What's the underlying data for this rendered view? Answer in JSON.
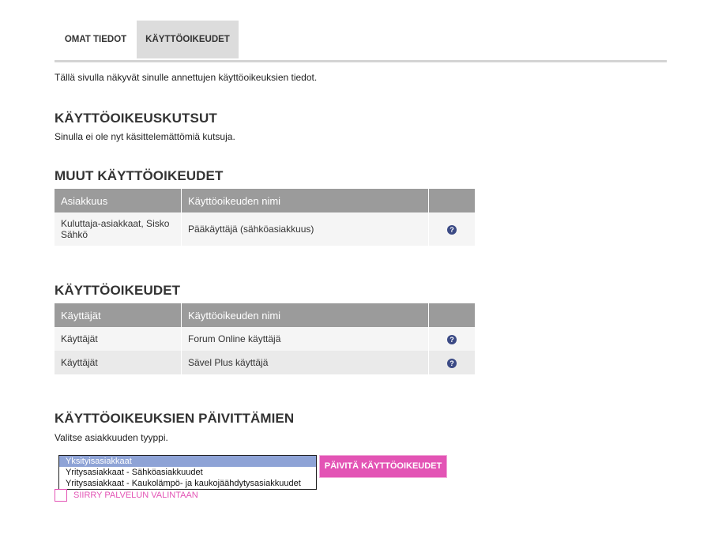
{
  "tabs": [
    {
      "label": "OMAT TIEDOT",
      "active": false
    },
    {
      "label": "KÄYTTÖOIKEUDET",
      "active": true
    }
  ],
  "intro": "Tällä sivulla näkyvät sinulle annettujen käyttöoikeuksien tiedot.",
  "invites": {
    "title": "KÄYTTÖOIKEUSKUTSUT",
    "text": "Sinulla ei ole nyt käsittelemättömiä kutsuja."
  },
  "other_rights": {
    "title": "MUUT KÄYTTÖOIKEUDET",
    "headers": [
      "Asiakkuus",
      "Käyttöoikeuden nimi"
    ],
    "rows": [
      {
        "col1": "Kuluttaja-asiakkaat, Sisko Sähkö",
        "col2": "Pääkäyttäjä (sähköasiakkuus)"
      }
    ]
  },
  "rights": {
    "title": "KÄYTTÖOIKEUDET",
    "headers": [
      "Käyttäjät",
      "Käyttöoikeuden nimi"
    ],
    "rows": [
      {
        "col1": "Käyttäjät",
        "col2": "Forum Online käyttäjä"
      },
      {
        "col1": "Käyttäjät",
        "col2": "Sävel Plus käyttäjä"
      }
    ]
  },
  "update": {
    "title": "KÄYTTÖOIKEUKSIEN PÄIVITTÄMIEN",
    "text": "Valitse asiakkuuden tyyppi.",
    "options": [
      "Yksityisasiakkaat",
      "Yritysasiakkaat - Sähköasiakkuudet",
      "Yritysasiakkaat - Kaukolämpö- ja kaukojäähdytysasiakkuudet"
    ],
    "selected_index": 0,
    "button_label": "PÄIVITÄ KÄYTTÖOIKEUDET",
    "move_link": "SIIRRY PALVELUN VALINTAAN"
  },
  "icons": {
    "help": "question-circle-icon",
    "move": "square-icon"
  },
  "colors": {
    "accent": "#e354b5",
    "table_header": "#9b9b9b",
    "help_icon": "#3b4a85",
    "selected_option": "#8ea3d6"
  }
}
